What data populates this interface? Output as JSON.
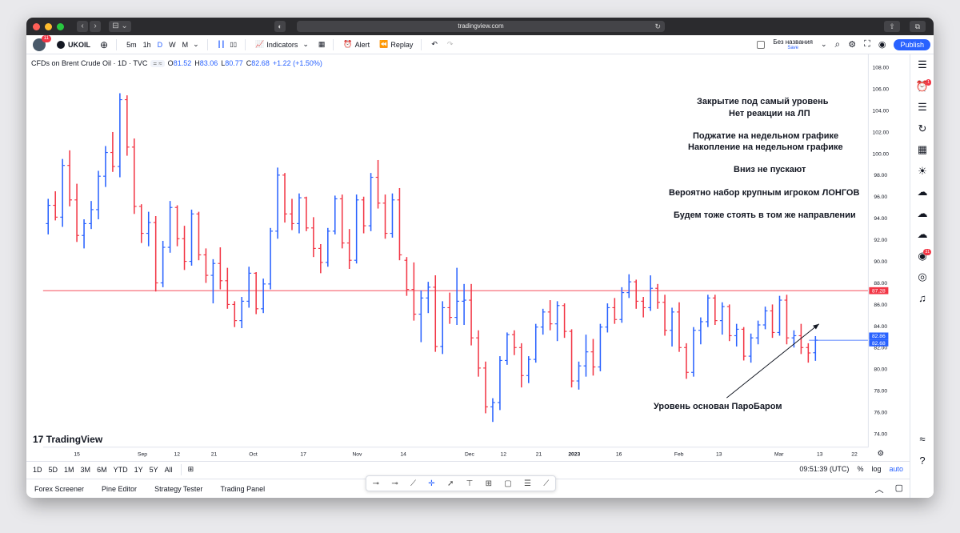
{
  "browser": {
    "url": "tradingview.com",
    "nav_back": "‹",
    "nav_forward": "›",
    "sidebar_btn": "⊟ ⌄",
    "shield": "◐",
    "reload": "↻",
    "share": "⇧",
    "tabs": "⧉"
  },
  "toolbar": {
    "avatar_badge": "11",
    "symbol": "UKOIL",
    "add": "⊕",
    "intervals": [
      "5m",
      "1h",
      "D",
      "W",
      "M"
    ],
    "interval_dropdown": "⌄",
    "bars_icon": "┃┃",
    "candles_icon": "▯▯",
    "indicators": "Indicators",
    "indicators_dropdown": "⌄",
    "templates_icon": "▦",
    "alert": "Alert",
    "replay": "Replay",
    "undo": "↶",
    "redo": "↷",
    "layout_name": "Без названия",
    "layout_save": "Save",
    "layout_dropdown": "⌄",
    "publish": "Publish",
    "search_icon": "⌕",
    "settings_icon": "⚙",
    "fullscreen_icon": "⛶",
    "camera_icon": "◉"
  },
  "legend": {
    "title": "CFDs on Brent Crude Oil · 1D · TVC",
    "buttons": "= ≈",
    "o_label": "O",
    "o": "81.52",
    "h_label": "H",
    "h": "83.06",
    "l_label": "L",
    "l": "80.77",
    "c_label": "C",
    "c": "82.68",
    "change": "+1.22 (+1.50%)"
  },
  "annotations": {
    "block1_line1": "Закрытие под самый уровень",
    "block1_line2": "Нет реакции на ЛП",
    "block2_line1": "Поджатие на недельном графике",
    "block2_line2": "Накопление на недельном графике",
    "block3": "Вниз не пускают",
    "block4": "Вероятно набор крупным игроком ЛОНГОВ",
    "block5": "Будем тоже стоять в том же направлении",
    "arrow_label": "Уровень основан ПароБаром"
  },
  "chart_data": {
    "type": "ohlc",
    "title": "CFDs on Brent Crude Oil · 1D · TVC",
    "y_axis_labels": [
      "108.00",
      "106.00",
      "104.00",
      "102.00",
      "100.00",
      "98.00",
      "96.00",
      "94.00",
      "92.00",
      "90.00",
      "88.00",
      "86.00",
      "84.00",
      "82.00",
      "80.00",
      "78.00",
      "76.00",
      "74.00"
    ],
    "ylim": [
      72.9,
      109.2
    ],
    "x_axis_labels": [
      "15",
      "Sep",
      "12",
      "21",
      "Oct",
      "17",
      "Nov",
      "14",
      "Dec",
      "12",
      "21",
      "2023",
      "16",
      "Feb",
      "13",
      "Mar",
      "13",
      "22"
    ],
    "level_line": 87.28,
    "level_label": "87.28",
    "price_label_upper": "82.86",
    "price_label_current": "82.68",
    "current_price": 82.68,
    "bars": [
      [
        93.5,
        95.8,
        92.5,
        95.2
      ],
      [
        95.2,
        96.5,
        93.8,
        94.1
      ],
      [
        94.1,
        99.5,
        93.2,
        98.9
      ],
      [
        98.9,
        100.3,
        95.1,
        95.7
      ],
      [
        95.7,
        97.2,
        91.8,
        92.4
      ],
      [
        92.4,
        93.9,
        91.2,
        93.5
      ],
      [
        93.5,
        95.6,
        93.0,
        94.8
      ],
      [
        94.8,
        98.4,
        93.9,
        97.9
      ],
      [
        97.9,
        100.7,
        96.9,
        100.1
      ],
      [
        100.1,
        102.0,
        98.3,
        98.8
      ],
      [
        98.8,
        105.6,
        97.8,
        105.0
      ],
      [
        105.0,
        105.4,
        99.8,
        100.6
      ],
      [
        100.6,
        101.4,
        94.4,
        95.1
      ],
      [
        95.1,
        95.3,
        91.7,
        92.6
      ],
      [
        92.6,
        94.6,
        91.4,
        93.6
      ],
      [
        93.6,
        94.2,
        87.2,
        88.0
      ],
      [
        88.0,
        91.9,
        87.6,
        91.3
      ],
      [
        91.3,
        95.6,
        90.8,
        95.0
      ],
      [
        95.0,
        95.2,
        91.4,
        92.1
      ],
      [
        92.1,
        93.3,
        89.2,
        90.0
      ],
      [
        90.0,
        94.8,
        89.6,
        94.4
      ],
      [
        94.4,
        94.6,
        90.1,
        90.6
      ],
      [
        90.6,
        91.2,
        88.0,
        88.7
      ],
      [
        88.7,
        90.2,
        86.1,
        89.8
      ],
      [
        89.8,
        91.3,
        87.4,
        88.2
      ],
      [
        88.2,
        89.4,
        85.6,
        86.0
      ],
      [
        86.0,
        86.3,
        83.9,
        84.5
      ],
      [
        84.5,
        86.7,
        83.8,
        86.3
      ],
      [
        86.3,
        89.5,
        85.7,
        88.9
      ],
      [
        88.9,
        89.0,
        85.1,
        85.6
      ],
      [
        85.6,
        88.4,
        85.2,
        87.9
      ],
      [
        87.9,
        93.1,
        87.4,
        92.8
      ],
      [
        92.8,
        98.7,
        92.1,
        98.0
      ],
      [
        98.0,
        98.2,
        93.6,
        94.4
      ],
      [
        94.4,
        95.8,
        92.9,
        93.5
      ],
      [
        93.5,
        96.3,
        92.6,
        95.9
      ],
      [
        95.9,
        96.0,
        92.8,
        93.1
      ],
      [
        93.1,
        94.1,
        90.4,
        91.2
      ],
      [
        91.2,
        91.6,
        88.9,
        89.9
      ],
      [
        89.9,
        93.1,
        89.5,
        92.8
      ],
      [
        92.8,
        96.1,
        92.5,
        95.8
      ],
      [
        95.8,
        96.2,
        91.2,
        91.7
      ],
      [
        91.7,
        93.0,
        89.3,
        90.1
      ],
      [
        90.1,
        96.2,
        89.8,
        95.7
      ],
      [
        95.7,
        96.0,
        92.6,
        93.3
      ],
      [
        93.3,
        98.2,
        92.8,
        97.8
      ],
      [
        97.8,
        99.4,
        94.9,
        95.4
      ],
      [
        95.4,
        96.2,
        92.1,
        92.6
      ],
      [
        92.6,
        96.3,
        92.2,
        95.7
      ],
      [
        95.7,
        96.8,
        90.1,
        90.6
      ],
      [
        90.1,
        90.4,
        86.8,
        87.4
      ],
      [
        87.4,
        89.9,
        84.5,
        85.1
      ],
      [
        85.1,
        87.3,
        82.5,
        86.6
      ],
      [
        86.6,
        88.1,
        85.2,
        87.6
      ],
      [
        87.6,
        88.7,
        81.6,
        82.1
      ],
      [
        82.1,
        86.3,
        81.4,
        85.7
      ],
      [
        85.7,
        87.1,
        84.2,
        84.8
      ],
      [
        84.8,
        89.4,
        84.1,
        86.3
      ],
      [
        86.3,
        87.9,
        84.1,
        86.4
      ],
      [
        86.4,
        87.9,
        82.2,
        82.9
      ],
      [
        82.9,
        83.6,
        79.3,
        80.1
      ],
      [
        80.1,
        80.7,
        75.9,
        76.5
      ],
      [
        76.5,
        77.3,
        75.1,
        76.9
      ],
      [
        76.9,
        81.2,
        76.2,
        80.8
      ],
      [
        80.8,
        83.4,
        80.4,
        83.2
      ],
      [
        83.2,
        83.6,
        81.3,
        82.0
      ],
      [
        82.0,
        82.4,
        78.3,
        79.4
      ],
      [
        79.4,
        81.2,
        78.7,
        80.9
      ],
      [
        80.9,
        84.2,
        80.6,
        83.9
      ],
      [
        83.9,
        85.6,
        83.2,
        85.3
      ],
      [
        85.3,
        86.4,
        83.6,
        84.2
      ],
      [
        84.2,
        86.3,
        82.6,
        85.9
      ],
      [
        85.9,
        86.1,
        82.9,
        83.5
      ],
      [
        83.5,
        83.7,
        78.3,
        78.9
      ],
      [
        78.9,
        80.7,
        78.1,
        80.3
      ],
      [
        80.3,
        83.2,
        79.3,
        81.6
      ],
      [
        81.6,
        82.8,
        79.4,
        80.2
      ],
      [
        80.2,
        84.2,
        79.8,
        83.9
      ],
      [
        83.9,
        86.1,
        83.4,
        85.7
      ],
      [
        85.7,
        86.6,
        84.2,
        84.6
      ],
      [
        84.6,
        87.6,
        84.3,
        87.1
      ],
      [
        87.1,
        88.8,
        86.6,
        88.1
      ],
      [
        88.1,
        88.3,
        85.6,
        86.3
      ],
      [
        86.3,
        86.7,
        84.8,
        85.7
      ],
      [
        85.7,
        88.7,
        85.4,
        87.5
      ],
      [
        87.5,
        87.9,
        85.6,
        86.2
      ],
      [
        86.2,
        86.9,
        83.1,
        83.6
      ],
      [
        83.6,
        85.7,
        82.1,
        85.3
      ],
      [
        85.3,
        86.2,
        81.6,
        82.0
      ],
      [
        82.0,
        82.4,
        79.1,
        79.7
      ],
      [
        79.7,
        83.9,
        79.3,
        83.6
      ],
      [
        83.6,
        84.8,
        82.3,
        84.4
      ],
      [
        84.4,
        86.9,
        83.9,
        86.6
      ],
      [
        86.6,
        86.9,
        84.1,
        84.5
      ],
      [
        84.5,
        86.2,
        83.2,
        85.8
      ],
      [
        85.8,
        86.0,
        82.6,
        83.1
      ],
      [
        83.1,
        84.2,
        82.1,
        83.7
      ],
      [
        83.7,
        83.9,
        80.8,
        81.2
      ],
      [
        81.2,
        83.3,
        80.6,
        82.9
      ],
      [
        82.9,
        84.5,
        82.3,
        84.1
      ],
      [
        84.1,
        85.8,
        83.7,
        85.4
      ],
      [
        85.4,
        86.0,
        82.9,
        83.4
      ],
      [
        83.4,
        86.8,
        83.1,
        86.4
      ],
      [
        86.4,
        86.9,
        82.3,
        82.9
      ],
      [
        82.9,
        83.6,
        82.0,
        83.1
      ],
      [
        83.1,
        84.2,
        81.4,
        82.0
      ],
      [
        82.0,
        82.4,
        80.6,
        81.5
      ],
      [
        81.52,
        83.06,
        80.77,
        82.68
      ]
    ]
  },
  "price_axis": {
    "settings": "⚙"
  },
  "branding": {
    "logo": "17 TradingView"
  },
  "range_bar": {
    "ranges": [
      "1D",
      "5D",
      "1M",
      "3M",
      "6M",
      "YTD",
      "1Y",
      "5Y",
      "All"
    ],
    "compare_icon": "⊞",
    "time": "09:51:39 (UTC)",
    "percent": "%",
    "log": "log",
    "auto": "auto"
  },
  "bottom_tabs": [
    "Forex Screener",
    "Pine Editor",
    "Strategy Tester",
    "Trading Panel"
  ],
  "bottom_right": {
    "collapse": "︿",
    "maximize": "▢"
  },
  "drawing_tools": [
    "⊸",
    "⊸",
    "⟋",
    "✛",
    "➚",
    "⊤",
    "⊞",
    "▢",
    "☰",
    "⟋"
  ],
  "right_sidebar": [
    {
      "icon": "☰"
    },
    {
      "icon": "⏰",
      "badge": "1"
    },
    {
      "icon": "☰"
    },
    {
      "icon": "↻"
    },
    {
      "icon": "▦"
    },
    {
      "icon": "☀"
    },
    {
      "icon": "☁"
    },
    {
      "icon": "☁"
    },
    {
      "icon": "☁"
    },
    {
      "icon": "◉",
      "badge": "31"
    },
    {
      "icon": "◎"
    },
    {
      "icon": "♫"
    },
    {
      "icon": "≈"
    },
    {
      "icon": "?"
    }
  ]
}
